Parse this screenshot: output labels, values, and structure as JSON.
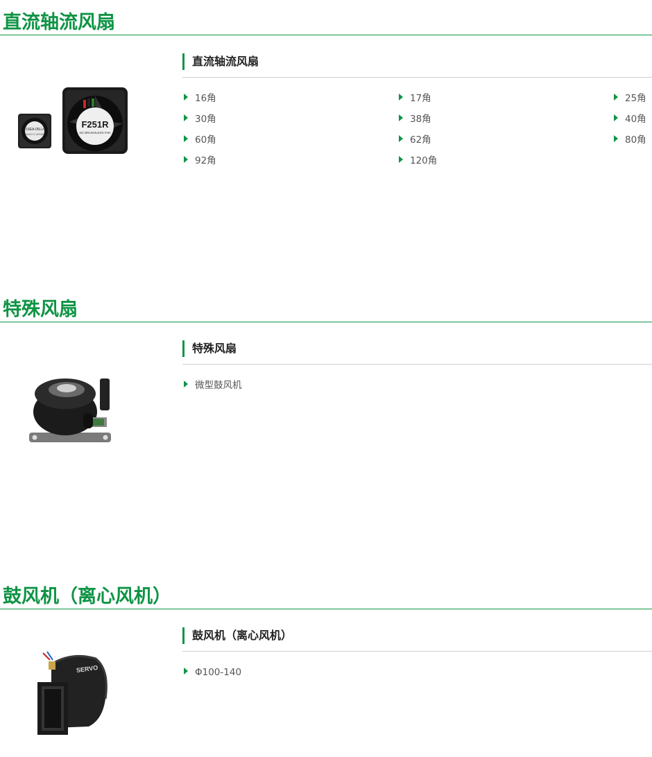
{
  "sections": [
    {
      "title": "直流轴流风扇",
      "sub_title": "直流轴流风扇",
      "items": [
        {
          "label": "16角"
        },
        {
          "label": "17角"
        },
        {
          "label": "25角"
        },
        {
          "label": "30角"
        },
        {
          "label": "38角"
        },
        {
          "label": "40角"
        },
        {
          "label": "60角"
        },
        {
          "label": "62角"
        },
        {
          "label": "80角"
        },
        {
          "label": "92角"
        },
        {
          "label": "120角"
        }
      ],
      "image": {
        "fan_small_label": "F16EA-05LLC",
        "fan_large_label": "F251R",
        "fan_large_sub": "DC BRUSHLESS FAN"
      }
    },
    {
      "title": "特殊风扇",
      "sub_title": "特殊风扇",
      "items": [
        {
          "label": "微型鼓风机"
        }
      ]
    },
    {
      "title": "鼓风机（离心风机）",
      "sub_title": "鼓风机（离心风机）",
      "items": [
        {
          "label": "Φ100-140"
        }
      ],
      "image": {
        "brand_label": "SERVO"
      }
    }
  ],
  "colors": {
    "accent": "#0f9445",
    "rule": "#cfcfcf",
    "text": "#555555"
  }
}
